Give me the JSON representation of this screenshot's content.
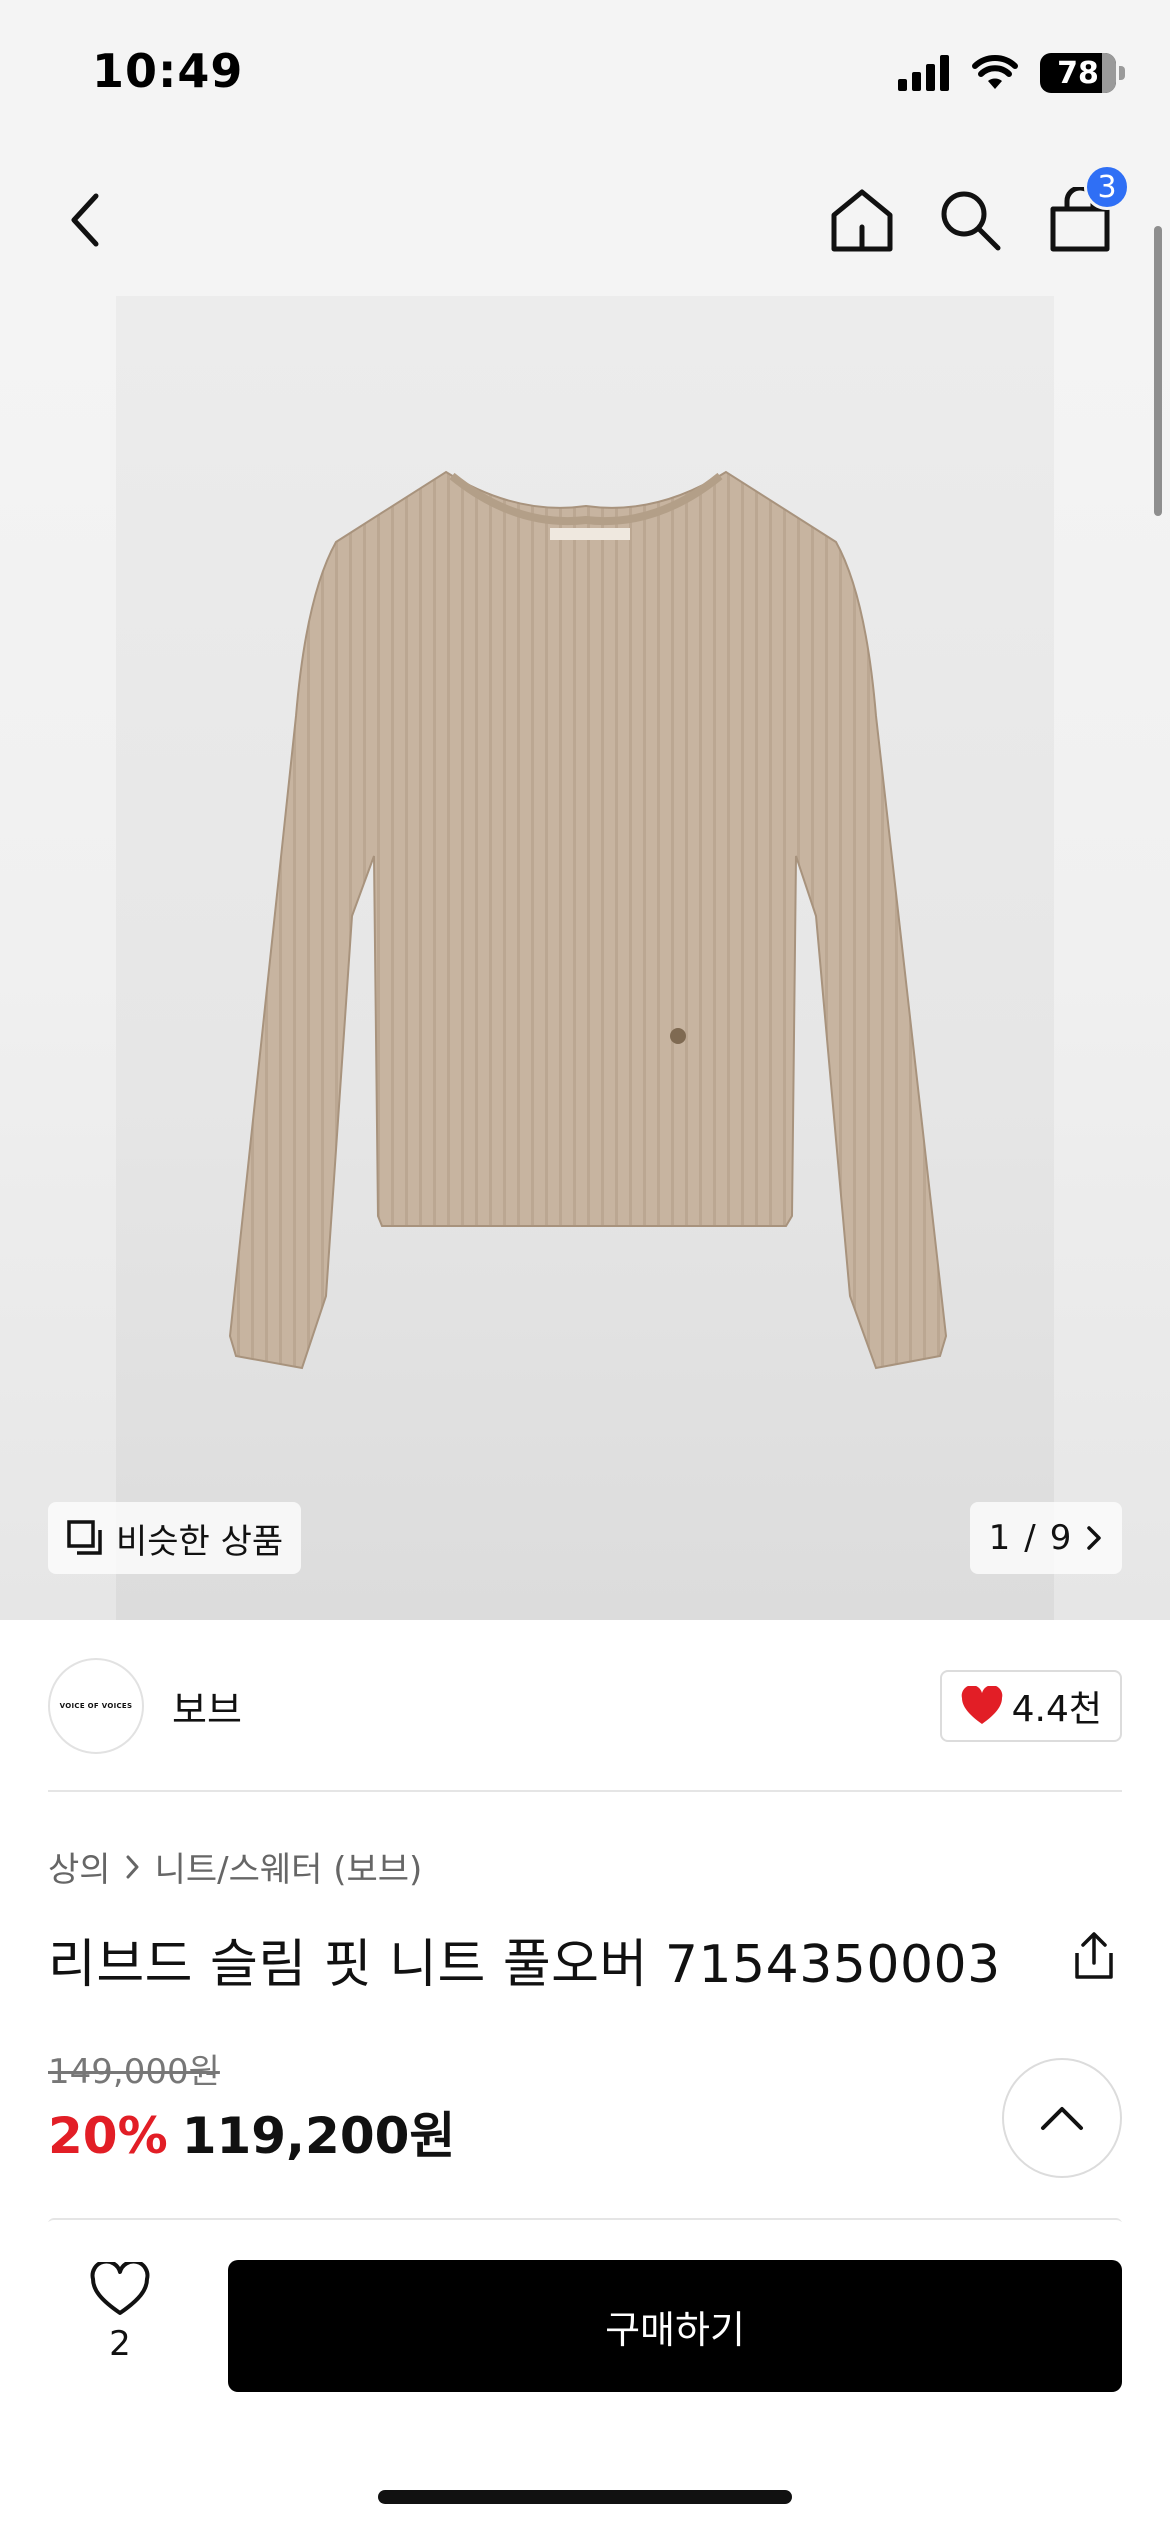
{
  "status_bar": {
    "time": "10:49",
    "battery": "78"
  },
  "nav": {
    "cart_count": "3"
  },
  "product_image": {
    "similar_label": "비슷한 상품",
    "pager": {
      "current": "1",
      "separator": "/",
      "total": "9"
    },
    "garment_color": "#c7b4a0"
  },
  "seller": {
    "logo_text": "VOICE OF VOICES",
    "name": "보브",
    "likes": "4.4천"
  },
  "product": {
    "breadcrumb": [
      "상의",
      "니트/스웨터 (보브)"
    ],
    "title": "리브드 슬림 핏 니트 풀오버 7154350003",
    "original_price": "149,000원",
    "discount": "20%",
    "sale_price": "119,200원"
  },
  "bottom_bar": {
    "wish_count": "2",
    "buy_label": "구매하기"
  },
  "colors": {
    "accent_red": "#e21e26",
    "badge_blue": "#2f6ff5",
    "buy_bg": "#000000"
  }
}
